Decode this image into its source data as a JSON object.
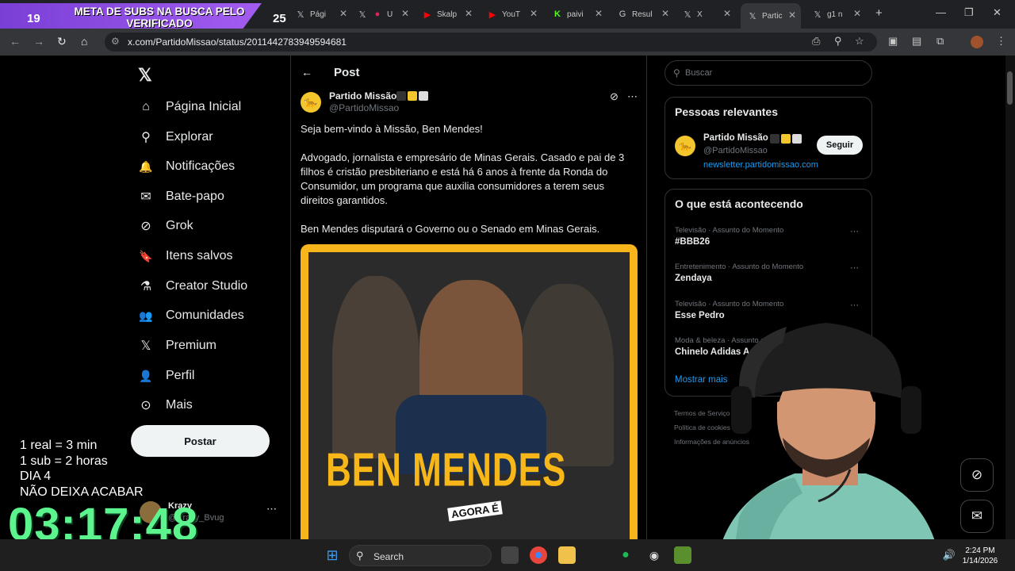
{
  "overlay": {
    "subs_left": "19",
    "subs_title": "META DE SUBS NA BUSCA PELO VERIFICADO",
    "subs_right": "25",
    "rules": [
      "1 real = 3 min",
      "1 sub = 2 horas",
      "DIA 4",
      "NÃO DEIXA ACABAR"
    ],
    "timer": "03:17:48"
  },
  "tabs": [
    {
      "label": "Pági",
      "icon": "X"
    },
    {
      "label": "U",
      "icon": "X"
    },
    {
      "label": "Skalp",
      "icon": "▶"
    },
    {
      "label": "YouT",
      "icon": "▶"
    },
    {
      "label": "paivi",
      "icon": "K"
    },
    {
      "label": "Resul",
      "icon": "G"
    },
    {
      "label": "X",
      "icon": "X"
    },
    {
      "label": "Partic",
      "icon": "X"
    },
    {
      "label": "g1 n",
      "icon": "X"
    }
  ],
  "address": {
    "url": "x.com/PartidoMissao/status/2011442783949594681"
  },
  "nav": {
    "items": [
      {
        "label": "Página Inicial",
        "icon": "home-icon",
        "glyph": "⌂"
      },
      {
        "label": "Explorar",
        "icon": "search-icon",
        "glyph": "⚲"
      },
      {
        "label": "Notificações",
        "icon": "bell-icon",
        "glyph": "🔔"
      },
      {
        "label": "Bate-papo",
        "icon": "mail-icon",
        "glyph": "✉"
      },
      {
        "label": "Grok",
        "icon": "grok-icon",
        "glyph": "⊘"
      },
      {
        "label": "Itens salvos",
        "icon": "bookmark-icon",
        "glyph": "🔖"
      },
      {
        "label": "Creator Studio",
        "icon": "flask-icon",
        "glyph": "⚗"
      },
      {
        "label": "Comunidades",
        "icon": "people-icon",
        "glyph": "👥"
      },
      {
        "label": "Premium",
        "icon": "x-logo-icon",
        "glyph": "𝕏"
      },
      {
        "label": "Perfil",
        "icon": "person-icon",
        "glyph": "👤"
      },
      {
        "label": "Mais",
        "icon": "more-circle-icon",
        "glyph": "⋯"
      }
    ],
    "post_button": "Postar",
    "account": {
      "name": "Krazy",
      "handle": "@Krazy_Bvug"
    }
  },
  "post": {
    "header": "Post",
    "author": "Partido Missão",
    "handle": "@PartidoMissao",
    "paragraphs": [
      "Seja bem-vindo à Missão, Ben Mendes!",
      "Advogado, jornalista e empresário de Minas Gerais. Casado e pai de 3 filhos é cristão presbiteriano e está há 6 anos à frente da Ronda do Consumidor, um programa que auxilia consumidores a terem seus direitos garantidos.",
      "Ben Mendes disputará o Governo ou o Senado em Minas Gerais."
    ],
    "image_headline": "BEN MENDES",
    "image_tag": "AGORA É"
  },
  "sidebar": {
    "search_placeholder": "Buscar",
    "relevant_title": "Pessoas relevantes",
    "relevant": {
      "name": "Partido Missão",
      "handle": "@PartidoMissao",
      "link": "newsletter.partidomissao.com",
      "follow": "Seguir"
    },
    "trending_title": "O que está acontecendo",
    "trends": [
      {
        "context": "Televisão · Assunto do Momento",
        "name": "#BBB26"
      },
      {
        "context": "Entretenimento · Assunto do Momento",
        "name": "Zendaya"
      },
      {
        "context": "Televisão · Assunto do Momento",
        "name": "Esse Pedro"
      },
      {
        "context": "Moda & beleza · Assunto d",
        "name": "Chinelo Adidas Adilett"
      }
    ],
    "show_more": "Mostrar mais",
    "footer": [
      "Termos de Serviço",
      "Política de cookies",
      "Informações de anúncios"
    ]
  },
  "taskbar": {
    "search": "Search",
    "time": "2:24 PM",
    "date": "1/14/2026"
  },
  "colors": {
    "accent": "#1d9bf0",
    "timer": "#5cf58d",
    "subs": "#8b4ae0",
    "card": "#f6b51a"
  }
}
